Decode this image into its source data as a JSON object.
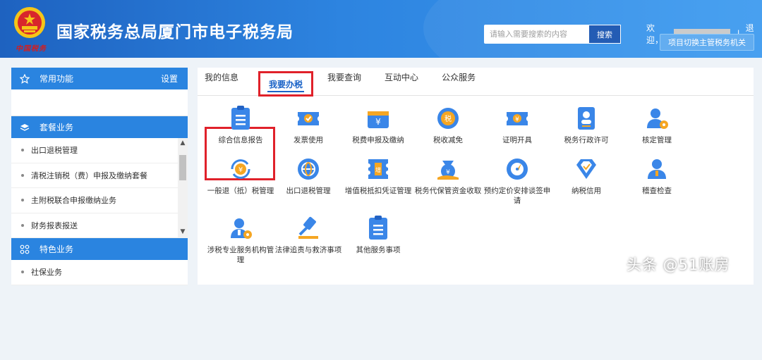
{
  "header": {
    "logo_script": "中国税务",
    "title": "国家税务总局厦门市电子税务局",
    "search_placeholder": "请输入需要搜索的内容",
    "search_label": "搜索",
    "welcome": "欢迎，",
    "divider": "|",
    "logout": "退出",
    "switch_label": "项目切换主管税务机关"
  },
  "sidebar": {
    "common": {
      "title": "常用功能",
      "settings": "设置"
    },
    "package": {
      "title": "套餐业务",
      "items": [
        "出口退税管理",
        "清税注销税（费）申报及缴纳套餐",
        "主附税联合申报缴纳业务",
        "财务报表报送"
      ]
    },
    "special": {
      "title": "特色业务",
      "items": [
        "社保业务"
      ]
    }
  },
  "tabs": [
    "我的信息",
    "我要办税",
    "我要查询",
    "互动中心",
    "公众服务"
  ],
  "active_tab": "我要办税",
  "services": [
    {
      "label": "综合信息报告",
      "icon": "report-icon"
    },
    {
      "label": "发票使用",
      "icon": "invoice-icon"
    },
    {
      "label": "税费申报及缴纳",
      "icon": "tax-payment-icon"
    },
    {
      "label": "税收减免",
      "icon": "tax-reduction-icon"
    },
    {
      "label": "证明开具",
      "icon": "certificate-icon"
    },
    {
      "label": "税务行政许可",
      "icon": "admin-permit-icon"
    },
    {
      "label": "核定管理",
      "icon": "assessment-icon"
    },
    {
      "label": "一般退（抵）税管理",
      "icon": "tax-refund-icon"
    },
    {
      "label": "出口退税管理",
      "icon": "export-refund-icon"
    },
    {
      "label": "增值税抵扣凭证管理",
      "icon": "vat-voucher-icon"
    },
    {
      "label": "税务代保管资金收取",
      "icon": "custody-fund-icon"
    },
    {
      "label": "预约定价安排谈签申请",
      "icon": "pricing-arrangement-icon"
    },
    {
      "label": "纳税信用",
      "icon": "tax-credit-icon"
    },
    {
      "label": "稽查检查",
      "icon": "inspection-icon"
    },
    {
      "label": "涉税专业服务机构管理",
      "icon": "agency-management-icon"
    },
    {
      "label": "法律追责与救济事项",
      "icon": "legal-gavel-icon"
    },
    {
      "label": "其他服务事项",
      "icon": "other-services-icon"
    }
  ],
  "watermark": "头条 @51账房",
  "colors": {
    "brand": "#2a84e0",
    "highlight": "#e0212a",
    "icon_blue": "#3a86e8",
    "icon_orange": "#f5a623"
  }
}
